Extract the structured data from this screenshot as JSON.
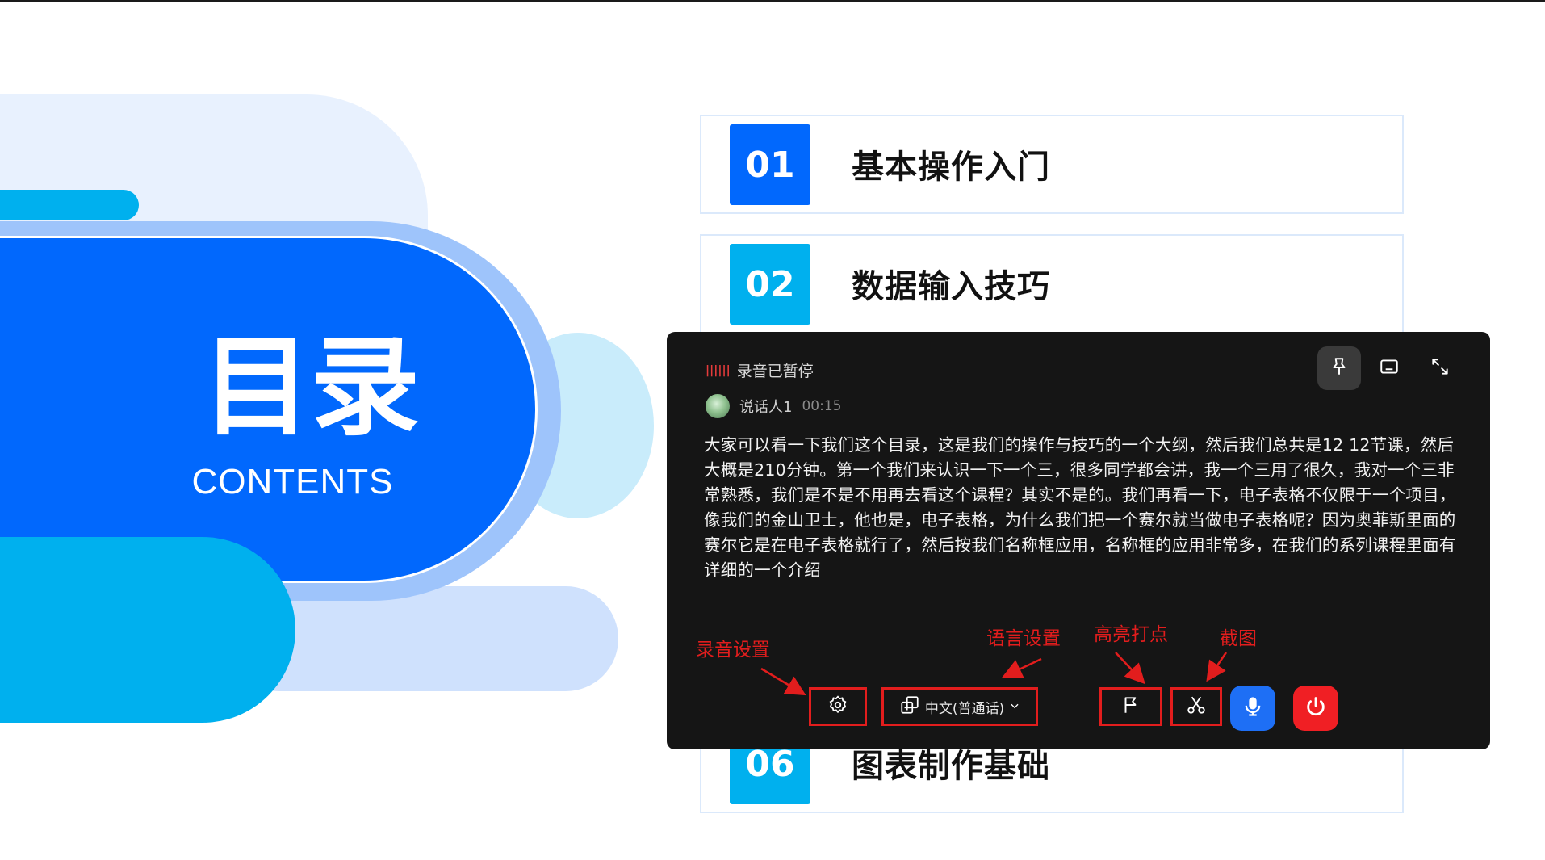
{
  "slide": {
    "title": "目录",
    "subtitle": "CONTENTS",
    "items": [
      {
        "num": "01",
        "title": "基本操作入门",
        "color": "#0168fd"
      },
      {
        "num": "02",
        "title": "数据输入技巧",
        "color": "#00b0ee"
      },
      {
        "num": "06",
        "title": "图表制作基础",
        "color": "#00b0ee"
      }
    ]
  },
  "panel": {
    "status_text": "录音已暂停",
    "speaker_name": "说话人1",
    "timestamp": "00:15",
    "transcript": "大家可以看一下我们这个目录，这是我们的操作与技巧的一个大纲，然后我们总共是12 12节课，然后大概是210分钟。第一个我们来认识一下一个三，很多同学都会讲，我一个三用了很久，我对一个三非常熟悉，我们是不是不用再去看这个课程？其实不是的。我们再看一下，电子表格不仅限于一个项目，像我们的金山卫士，他也是，电子表格，为什么我们把一个赛尔就当做电子表格呢？因为奥菲斯里面的赛尔它是在电子表格就行了，然后按我们名称框应用，名称框的应用非常多，在我们的系列课程里面有详细的一个介绍",
    "language": "中文(普通话)",
    "annotations": {
      "recording_settings": "录音设置",
      "language_settings": "语言设置",
      "highlight": "高亮打点",
      "screenshot": "截图"
    },
    "icons": {
      "pin": "pin-icon",
      "subtitle": "subtitle-icon",
      "expand": "expand-icon",
      "settings": "gear-icon",
      "language": "translate-icon",
      "flag": "flag-icon",
      "scissors": "scissors-icon",
      "mic": "microphone-icon",
      "power": "power-icon"
    },
    "colors": {
      "mic_button": "#1e6ff5",
      "stop_button": "#f01f24",
      "highlight_box": "#e21d1d"
    }
  }
}
